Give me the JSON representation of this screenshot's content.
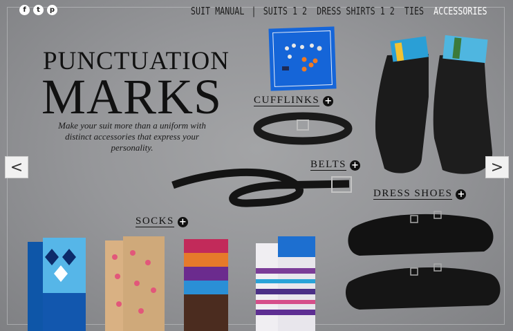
{
  "social": [
    {
      "name": "facebook-icon",
      "glyph": "f"
    },
    {
      "name": "twitter-icon",
      "glyph": "t"
    },
    {
      "name": "pinterest-icon",
      "glyph": "p"
    }
  ],
  "nav": {
    "suit_manual": "SUIT MANUAL",
    "separator": "|",
    "suits": "SUITS 1 2",
    "dress_shirts": "DRESS SHIRTS 1 2",
    "ties": "TIES",
    "accessories": "ACCESSORIES"
  },
  "headline": {
    "line1": "PUNCTUATION",
    "line2": "MARKS"
  },
  "tagline": "Make your suit more than a uniform with distinct accessories that express your personality.",
  "arrows": {
    "prev": "<",
    "next": ">"
  },
  "categories": {
    "cufflinks": "CUFFLINKS",
    "belts": "BELTS",
    "dress_shoes": "DRESS SHOES",
    "socks": "SOCKS",
    "plus": "+"
  },
  "colors": {
    "active_nav": "#ffffff",
    "background": "#96979a",
    "accent": "#111111"
  }
}
